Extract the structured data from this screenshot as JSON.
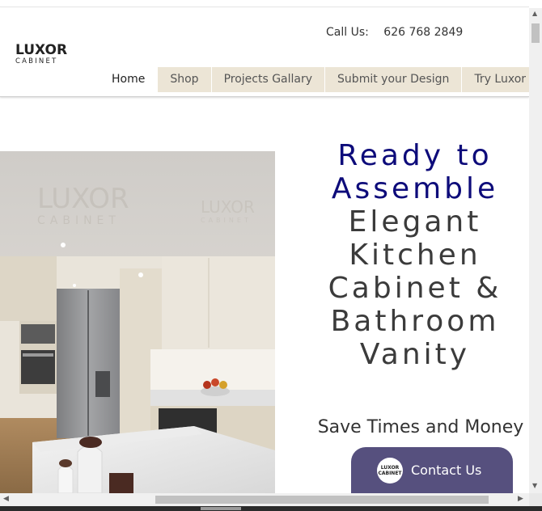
{
  "header": {
    "call_label": "Call Us:",
    "phone": "626 768 2849"
  },
  "logo": {
    "word": "LUXOR",
    "sub": "CABINET"
  },
  "nav": {
    "items": [
      {
        "label": "Home",
        "active": true
      },
      {
        "label": "Shop"
      },
      {
        "label": "Projects Gallary"
      },
      {
        "label": "Submit your Design"
      },
      {
        "label": "Try Luxor for F"
      }
    ]
  },
  "hero": {
    "line1": "Ready to",
    "line2": "Assemble",
    "line3": "Elegant",
    "line4": "Kitchen",
    "line5": "Cabinet &",
    "line6": "Bathroom",
    "line7": "Vanity",
    "tagline": "Save Times and Money",
    "image_watermark": "LUXOR CABINET"
  },
  "contact": {
    "label": "Contact Us",
    "badge_word": "LUXOR",
    "badge_sub": "CABINET"
  },
  "colors": {
    "headline_blue": "#0d0b7a",
    "nav_bg": "#ece5d6",
    "contact_bg": "#56507e"
  }
}
